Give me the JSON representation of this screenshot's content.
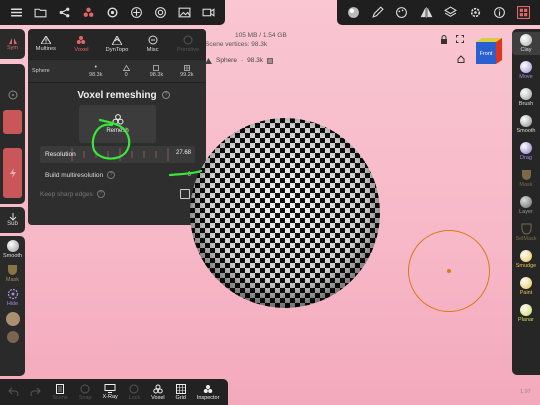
{
  "scene": {
    "memory": "105 MB / 1.54 GB",
    "vertices": "Scene vertices: 98.3k",
    "object_name": "Sphere",
    "object_verts": "98.3k"
  },
  "view_cube": {
    "label": "Front"
  },
  "left_sidebar": {
    "sym_label": "Sym",
    "sub_label": "Sub",
    "smooth_label": "Smooth",
    "mask_label": "Mask",
    "hide_label": "Hide"
  },
  "panel": {
    "tabs": [
      {
        "label": "Multires"
      },
      {
        "label": "Voxel"
      },
      {
        "label": "DynTopo"
      },
      {
        "label": "Misc"
      },
      {
        "label": "Primitive"
      }
    ],
    "stats": {
      "name": "Sphere",
      "col1": "98.3k",
      "col2": "0",
      "col3": "98.3k",
      "col4": "99.2k"
    },
    "title": "Voxel remeshing",
    "remesh_label": "Remesh",
    "resolution_label": "Resolution",
    "resolution_value": "27.68",
    "multires_label": "Build multiresolution",
    "multires_value": "0",
    "sharp_label": "Keep sharp edges"
  },
  "right_sidebar": {
    "tools": [
      {
        "label": "Clay"
      },
      {
        "label": "Move"
      },
      {
        "label": "Brush"
      },
      {
        "label": "Smooth"
      },
      {
        "label": "Drag"
      },
      {
        "label": "Mask"
      },
      {
        "label": "Layer"
      },
      {
        "label": "SelMask"
      },
      {
        "label": "Smudge"
      },
      {
        "label": "Paint"
      },
      {
        "label": "Planar"
      }
    ]
  },
  "bottom_bar": {
    "items": [
      {
        "label": ""
      },
      {
        "label": ""
      },
      {
        "label": "Scene"
      },
      {
        "label": "Snap"
      },
      {
        "label": "X-Ray"
      },
      {
        "label": "Lock"
      },
      {
        "label": "Voxel"
      },
      {
        "label": "Grid"
      },
      {
        "label": "Inspector"
      }
    ]
  },
  "version": "1.97",
  "colors": {
    "accent": "#e06767",
    "brush_cursor": "#d87a1b",
    "annotation": "#39e639",
    "background": "#f7b8c8"
  }
}
